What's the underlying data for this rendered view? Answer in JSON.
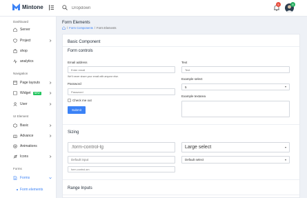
{
  "app": {
    "name": "Mintone"
  },
  "topbar": {
    "search_placeholder": "Dropdown",
    "notification_count": "5",
    "avatar_count": "8"
  },
  "sidebar": {
    "sections": [
      {
        "label": "Dashboard"
      },
      {
        "label": "Navigation"
      },
      {
        "label": "UI Element"
      },
      {
        "label": "Forms"
      }
    ],
    "items": [
      {
        "label": "Server"
      },
      {
        "label": "Project"
      },
      {
        "label": "shop"
      },
      {
        "label": "analytics"
      },
      {
        "label": "Page layouts"
      },
      {
        "label": "Widget",
        "badge": "NEW"
      },
      {
        "label": "User"
      },
      {
        "label": "Basic"
      },
      {
        "label": "Advance"
      },
      {
        "label": "Animations"
      },
      {
        "label": "Icons"
      },
      {
        "label": "Forms"
      }
    ],
    "subitem": {
      "label": "Form elements"
    }
  },
  "page": {
    "title": "Form Elements",
    "breadcrumb": [
      "Form Components",
      "Form Elements"
    ]
  },
  "card": {
    "title": "Basic Component",
    "form_controls": {
      "title": "Form controls",
      "email_label": "Email address",
      "email_placeholder": "Enter email",
      "email_help": "We'll never share your email with anyone else.",
      "password_label": "Password",
      "password_placeholder": "Password",
      "check_label": "Check me out",
      "submit_label": "Submit",
      "text_label": "Text",
      "text_placeholder": "Text",
      "select_label": "Example select",
      "select_value": "5",
      "textarea_label": "Example textarea"
    },
    "sizing": {
      "title": "Sizing",
      "large_placeholder": ".form-control-lg",
      "default_placeholder": "Default input",
      "small_placeholder": "form-control-sm",
      "large_select": "Large select",
      "default_select": "Default select"
    },
    "range": {
      "title": "Range Inputs"
    }
  },
  "colors": {
    "accent": "#3b82f6",
    "badge_red": "#e74c3c",
    "badge_green": "#27ae60",
    "new_badge": "#22c55e"
  }
}
